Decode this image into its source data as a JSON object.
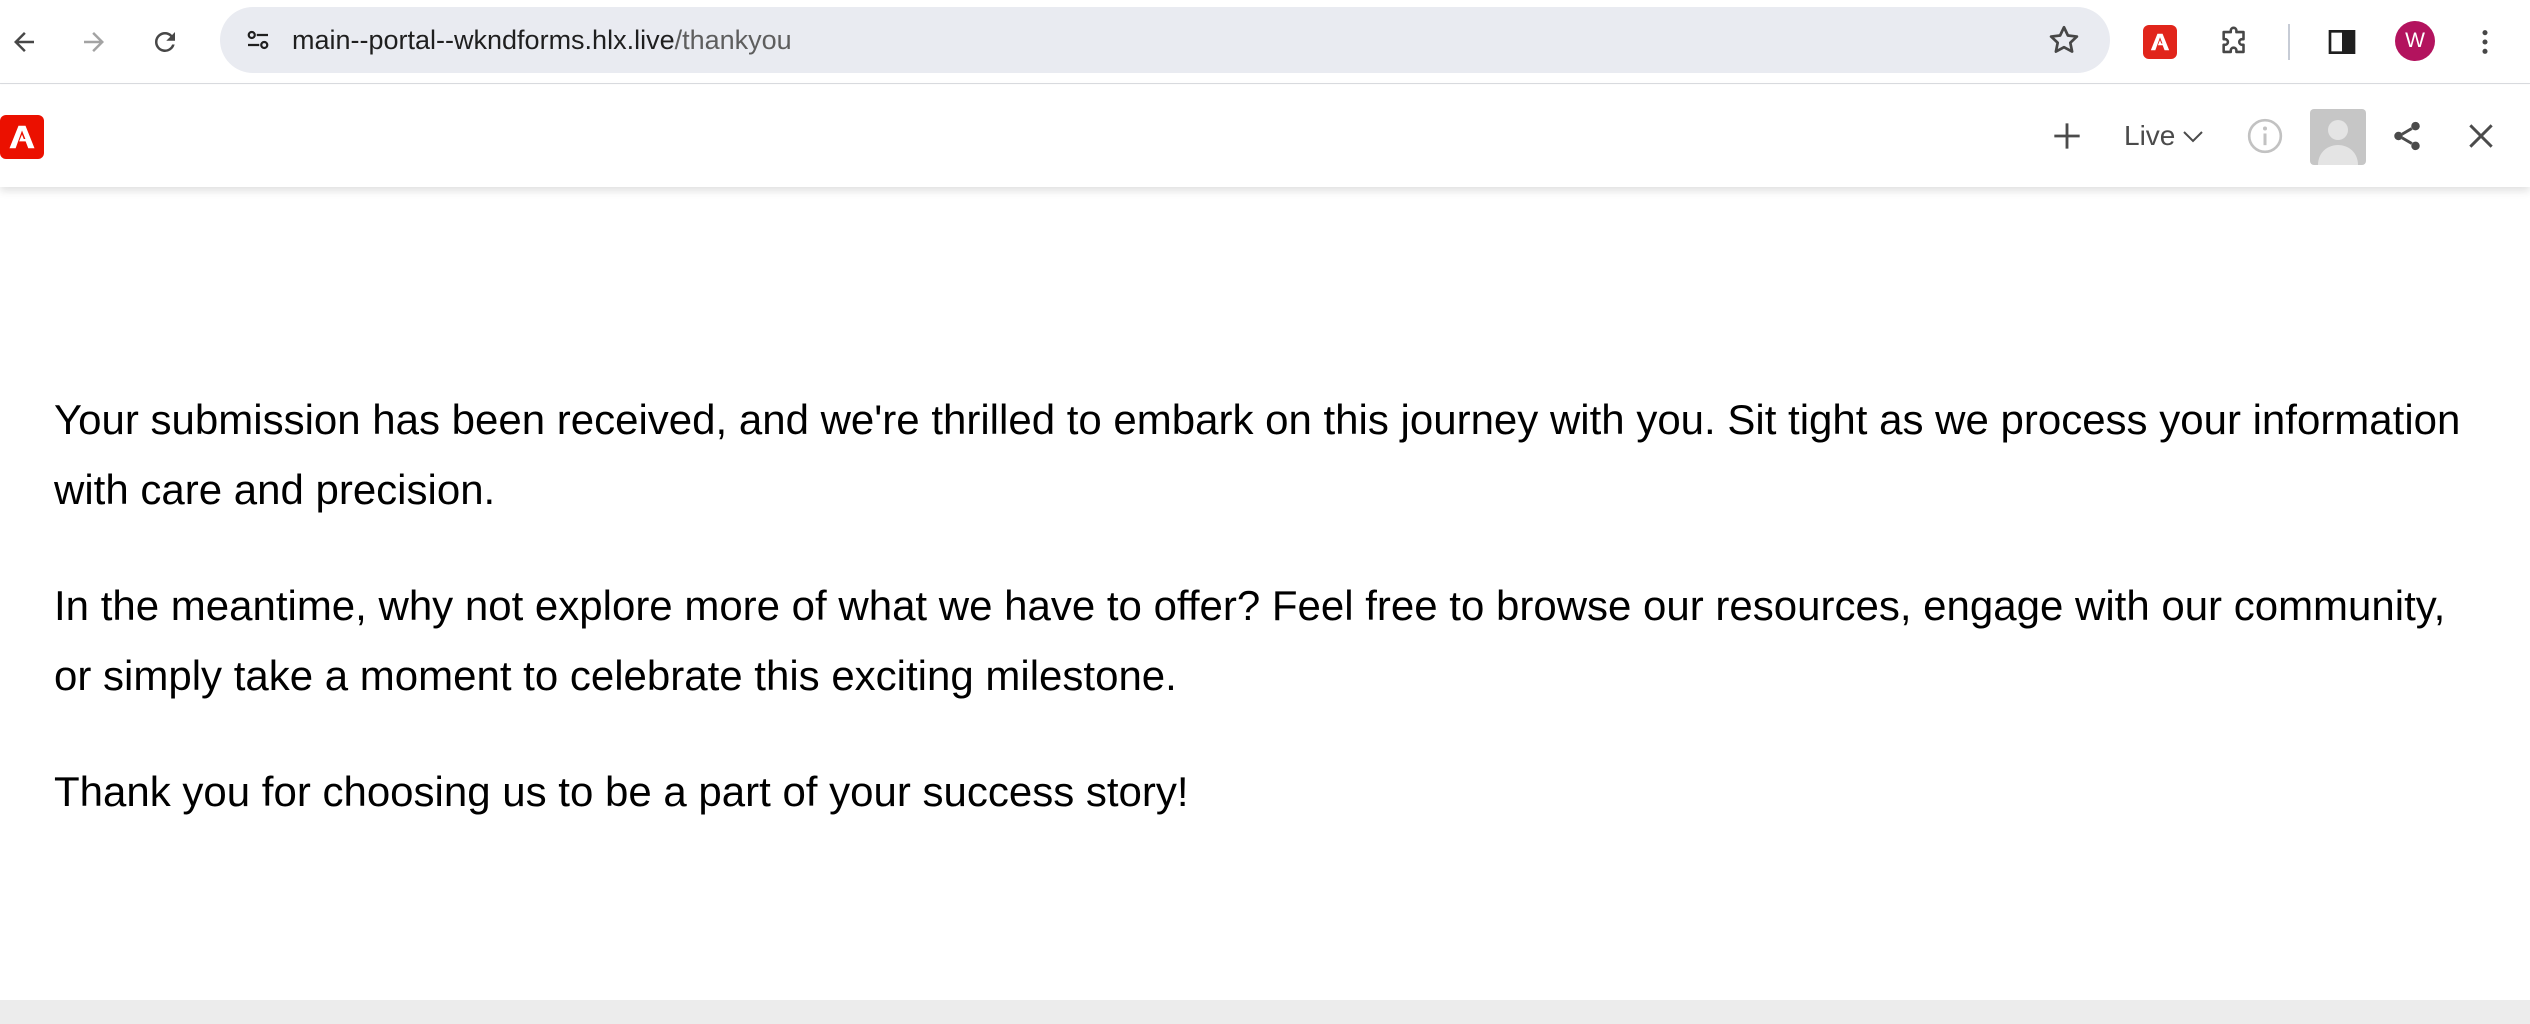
{
  "browser": {
    "url_domain": "main--portal--wkndforms.hlx.live",
    "url_path": "/thankyou",
    "profile_initial": "W",
    "icons": [
      "back-icon",
      "forward-icon",
      "reload-icon",
      "site-info-icon",
      "bookmark-star-icon",
      "adobe-extension-icon",
      "extensions-icon",
      "side-panel-icon",
      "menu-icon"
    ],
    "colors": {
      "profile": "#b3135e",
      "omnibox": "#e9ebf1",
      "adobe_red": "#eb1000"
    }
  },
  "sidekick": {
    "env_label": "Live",
    "icons": [
      "adobe-logo-icon",
      "add-icon",
      "chevron-down-icon",
      "info-icon",
      "user-avatar-icon",
      "share-icon",
      "close-icon"
    ]
  },
  "content": {
    "paragraphs": [
      "Your submission has been received, and we're thrilled to embark on this journey with you. Sit tight as we process your information with care and precision.",
      "In the meantime, why not explore more of what we have to offer? Feel free to browse our resources, engage with our community, or simply take a moment to celebrate this exciting milestone.",
      "Thank you for choosing us to be a part of your success story!"
    ]
  }
}
